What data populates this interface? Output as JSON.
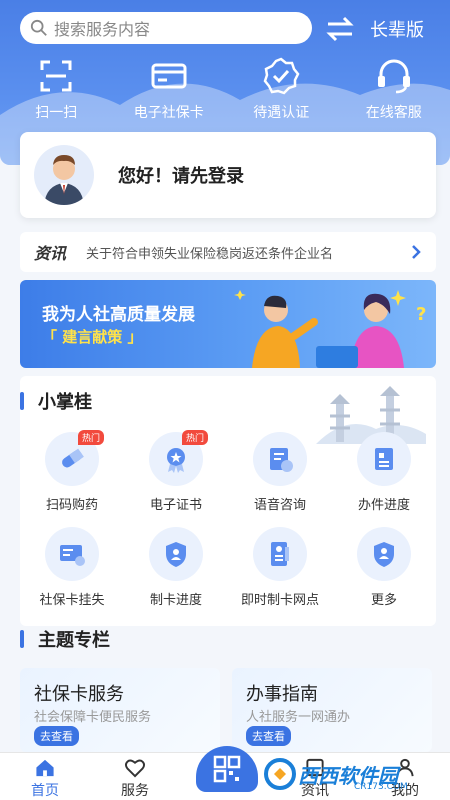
{
  "header": {
    "search_placeholder": "搜索服务内容",
    "elder_mode": "长辈版",
    "quick_actions": [
      {
        "label": "扫一扫",
        "icon": "scan-icon"
      },
      {
        "label": "电子社保卡",
        "icon": "card-icon"
      },
      {
        "label": "待遇认证",
        "icon": "verify-badge-icon"
      },
      {
        "label": "在线客服",
        "icon": "headset-icon"
      }
    ]
  },
  "login": {
    "prompt": "您好！请先登录"
  },
  "news": {
    "tag": "资讯",
    "headline": "关于符合申领失业保险稳岗返还条件企业名"
  },
  "banner": {
    "line1": "我为人社高质量发展",
    "line2": "「 建言献策 」"
  },
  "section_xzg": {
    "title": "小掌桂",
    "items": [
      {
        "label": "扫码购药",
        "badge": "热门",
        "icon": "medicine-icon"
      },
      {
        "label": "电子证书",
        "badge": "热门",
        "icon": "certificate-icon"
      },
      {
        "label": "语音咨询",
        "badge": "",
        "icon": "voice-consult-icon"
      },
      {
        "label": "办件进度",
        "badge": "",
        "icon": "progress-doc-icon"
      },
      {
        "label": "社保卡挂失",
        "badge": "",
        "icon": "card-loss-icon"
      },
      {
        "label": "制卡进度",
        "badge": "",
        "icon": "card-progress-icon"
      },
      {
        "label": "即时制卡网点",
        "badge": "",
        "icon": "instant-card-icon"
      },
      {
        "label": "更多",
        "badge": "",
        "icon": "more-icon"
      }
    ]
  },
  "topics": {
    "title": "主题专栏",
    "cards": [
      {
        "title": "社保卡服务",
        "desc": "社会保障卡便民服务",
        "action": "去查看"
      },
      {
        "title": "办事指南",
        "desc": "人社服务一网通办",
        "action": "去查看"
      }
    ]
  },
  "tabbar": {
    "items": [
      "首页",
      "服务",
      "资讯",
      "我的"
    ]
  },
  "watermark": {
    "text": "西西软件园",
    "sub": "CR173.COM"
  },
  "colors": {
    "primary": "#3b73e2",
    "hot": "#f24a3d",
    "banner_accent": "#ffe24a"
  }
}
